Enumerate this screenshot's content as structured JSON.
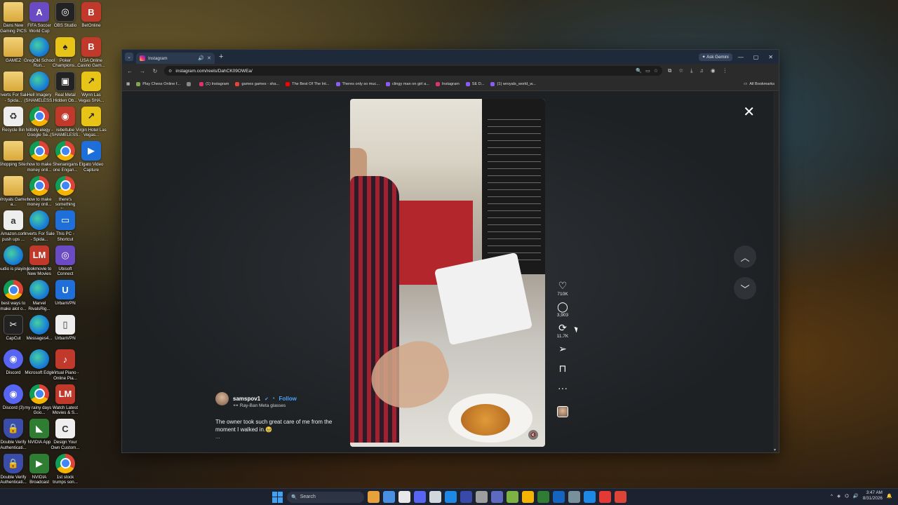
{
  "desktop_icons": [
    {
      "label": "Dans New Gaming PICS",
      "kind": "folder",
      "icon": "folder-icon"
    },
    {
      "label": "FIFA Soccer World Cup",
      "kind": "purple",
      "icon": "game-icon",
      "glyph": "A"
    },
    {
      "label": "OBS Studio",
      "kind": "dark",
      "icon": "obs-icon",
      "glyph": "◎"
    },
    {
      "label": "BetOnline",
      "kind": "red",
      "icon": "betonline-icon",
      "glyph": "B"
    },
    {
      "label": "GAMEZ",
      "kind": "folder",
      "icon": "folder-icon"
    },
    {
      "label": "GregOkl School Run...",
      "kind": "edge",
      "icon": "edge-icon"
    },
    {
      "label": "Poker Champions...",
      "kind": "yellow",
      "icon": "poker-icon",
      "glyph": "♠"
    },
    {
      "label": "USA Online Casino Gam...",
      "kind": "red",
      "icon": "casino-icon",
      "glyph": "B"
    },
    {
      "label": "Inverts For Sale - Spida...",
      "kind": "folder",
      "icon": "folder-icon"
    },
    {
      "label": "Hell Imagery (SHAMELESS...",
      "kind": "edge",
      "icon": "edge-icon"
    },
    {
      "label": "Real Metal Hidden Ob...",
      "kind": "dark",
      "icon": "game-icon",
      "glyph": "▣"
    },
    {
      "label": "Wynn Las Vegas SHA...",
      "kind": "yellow",
      "icon": "shortcut-icon",
      "glyph": "↗"
    },
    {
      "label": "Recycle Bin",
      "kind": "white",
      "icon": "recycle-bin-icon",
      "glyph": "♻"
    },
    {
      "label": "hillbilly elegy - Google Se...",
      "kind": "chrome",
      "icon": "chrome-icon"
    },
    {
      "label": "rebeltube (SHAMELESS...",
      "kind": "red",
      "icon": "app-icon",
      "glyph": "◉"
    },
    {
      "label": "Virgin Hotel Las Vegas...",
      "kind": "yellow",
      "icon": "shortcut-icon",
      "glyph": "↗"
    },
    {
      "label": "Shopping Sites",
      "kind": "folder",
      "icon": "folder-icon"
    },
    {
      "label": "how to make money onli...",
      "kind": "chrome",
      "icon": "chrome-icon"
    },
    {
      "label": "Shenanigans one Engan...",
      "kind": "chrome",
      "icon": "chrome-icon"
    },
    {
      "label": "Elgato Video Capture",
      "kind": "blue",
      "icon": "elgato-icon",
      "glyph": "▶"
    },
    {
      "label": "Wroyals Games a...",
      "kind": "folder",
      "icon": "folder-icon"
    },
    {
      "label": "how to make money onli...",
      "kind": "chrome",
      "icon": "chrome-icon"
    },
    {
      "label": "there's something Pla...",
      "kind": "chrome",
      "icon": "chrome-icon"
    },
    {
      "label": "",
      "kind": "none",
      "icon": "empty-slot"
    },
    {
      "label": "Amazon.com push ups ...",
      "kind": "white",
      "icon": "amazon-icon",
      "glyph": "a"
    },
    {
      "label": "Inverts For Sale - Spida...",
      "kind": "edge",
      "icon": "edge-icon"
    },
    {
      "label": "This PC - Shortcut",
      "kind": "blue",
      "icon": "this-pc-icon",
      "glyph": "▭"
    },
    {
      "label": "",
      "kind": "none",
      "icon": "empty-slot"
    },
    {
      "label": "Audio is playing",
      "kind": "edge",
      "icon": "edge-icon"
    },
    {
      "label": "lookmovie to New Movies",
      "kind": "red",
      "icon": "lookmovie-icon",
      "glyph": "LM"
    },
    {
      "label": "Ubisoft Connect",
      "kind": "purple",
      "icon": "ubisoft-icon",
      "glyph": "◎"
    },
    {
      "label": "",
      "kind": "none",
      "icon": "empty-slot"
    },
    {
      "label": "best ways to make alot o...",
      "kind": "chrome",
      "icon": "chrome-icon"
    },
    {
      "label": "Marvel RivalsRig...",
      "kind": "edge",
      "icon": "edge-icon"
    },
    {
      "label": "UrbanVPN",
      "kind": "blue",
      "icon": "urbanvpn-icon",
      "glyph": "U"
    },
    {
      "label": "",
      "kind": "none",
      "icon": "empty-slot"
    },
    {
      "label": "CapCut",
      "kind": "dark",
      "icon": "capcut-icon",
      "glyph": "✂"
    },
    {
      "label": "Messages4...",
      "kind": "edge",
      "icon": "edge-icon"
    },
    {
      "label": "UrbanVPN",
      "kind": "white",
      "icon": "file-icon",
      "glyph": "▯"
    },
    {
      "label": "",
      "kind": "none",
      "icon": "empty-slot"
    },
    {
      "label": "Discord",
      "kind": "discord",
      "icon": "discord-icon",
      "glyph": "◉"
    },
    {
      "label": "Microsoft Edge",
      "kind": "edge",
      "icon": "edge-icon"
    },
    {
      "label": "Virtual Piano - Online Pia...",
      "kind": "red",
      "icon": "piano-icon",
      "glyph": "♪"
    },
    {
      "label": "",
      "kind": "none",
      "icon": "empty-slot"
    },
    {
      "label": "Discord (3)",
      "kind": "discord",
      "icon": "discord-icon",
      "glyph": "◉"
    },
    {
      "label": "my rainy days - Goo...",
      "kind": "chrome",
      "icon": "chrome-icon"
    },
    {
      "label": "Watch Latest Movies & S...",
      "kind": "red",
      "icon": "lookmovie-icon",
      "glyph": "LM"
    },
    {
      "label": "",
      "kind": "none",
      "icon": "empty-slot"
    },
    {
      "label": "Double Verify Authenticati...",
      "kind": "shield",
      "icon": "shield-icon",
      "glyph": "🔒"
    },
    {
      "label": "NVIDIA App",
      "kind": "green",
      "icon": "nvidia-icon",
      "glyph": "◣"
    },
    {
      "label": "Design Your Own Custom...",
      "kind": "white",
      "icon": "design-icon",
      "glyph": "C"
    },
    {
      "label": "",
      "kind": "none",
      "icon": "empty-slot"
    },
    {
      "label": "Double Verify Authenticati...",
      "kind": "shield",
      "icon": "shield-icon",
      "glyph": "🔒"
    },
    {
      "label": "NVIDIA Broadcast",
      "kind": "green",
      "icon": "nvidia-broadcast-icon",
      "glyph": "▶"
    },
    {
      "label": "1st stock trumps son...",
      "kind": "chrome",
      "icon": "chrome-icon"
    }
  ],
  "browser": {
    "tab_title": "Instagram",
    "new_tab_glyph": "+",
    "ask_gemini": "Ask Gemini",
    "window_controls": [
      "—",
      "▢",
      "✕"
    ],
    "url": "instagram.com/reels/DahCK09OWEa/",
    "bookmarks": [
      {
        "label": "Play Chess Online f...",
        "color": "#7fa650"
      },
      {
        "label": "",
        "color": "#888"
      },
      {
        "label": "(1) Instagram",
        "color": "#e1306c"
      },
      {
        "label": "games games - sha...",
        "color": "#ea4335"
      },
      {
        "label": "The Best Of The Int...",
        "color": "#ff0000"
      },
      {
        "label": "Theres only so muc...",
        "color": "#8a5cf5"
      },
      {
        "label": "clingy man on girl a...",
        "color": "#8a5cf5"
      },
      {
        "label": "Instagram",
        "color": "#e1306c"
      },
      {
        "label": "SE D...",
        "color": "#8a5cf5"
      },
      {
        "label": "(1) wroyals_world_w...",
        "color": "#8a5cf5"
      }
    ],
    "all_bookmarks": "All Bookmarks"
  },
  "reel": {
    "username": "samspov1",
    "verified_glyph": "✔",
    "follow": "Follow",
    "dot": "•",
    "subtitle": "Ray-Ban Meta glasses",
    "caption": "The owner took such great care of me from the moment I walked in.🥹",
    "more": "...",
    "actions": [
      {
        "name": "like",
        "glyph": "♡",
        "count": "710K",
        "icon": "heart-icon"
      },
      {
        "name": "comment",
        "glyph": "◯",
        "count": "3,903",
        "icon": "comment-icon"
      },
      {
        "name": "repost",
        "glyph": "⟳",
        "count": "11.7K",
        "icon": "repost-icon"
      },
      {
        "name": "share",
        "glyph": "➢",
        "count": "",
        "icon": "share-icon"
      },
      {
        "name": "save",
        "glyph": "⊓",
        "count": "",
        "icon": "bookmark-icon"
      },
      {
        "name": "more",
        "glyph": "···",
        "count": "",
        "icon": "more-icon"
      }
    ],
    "close_glyph": "✕",
    "up_glyph": "︿",
    "down_glyph": "﹀",
    "mute_glyph": "🔇"
  },
  "taskbar": {
    "search_label": "Search",
    "apps": [
      "#e9a23b",
      "#4a90e2",
      "#e8e8e8",
      "#5865f2",
      "#cfd8dc",
      "#1e88e5",
      "#3949ab",
      "#9e9e9e",
      "#5c6bc0",
      "#7cb342",
      "#f4b400",
      "#2e7d32",
      "#1565c0",
      "#78909c",
      "#1e88e5",
      "#e53935",
      "#db4437"
    ],
    "time": "3:47 AM",
    "date": "8/31/2026"
  }
}
